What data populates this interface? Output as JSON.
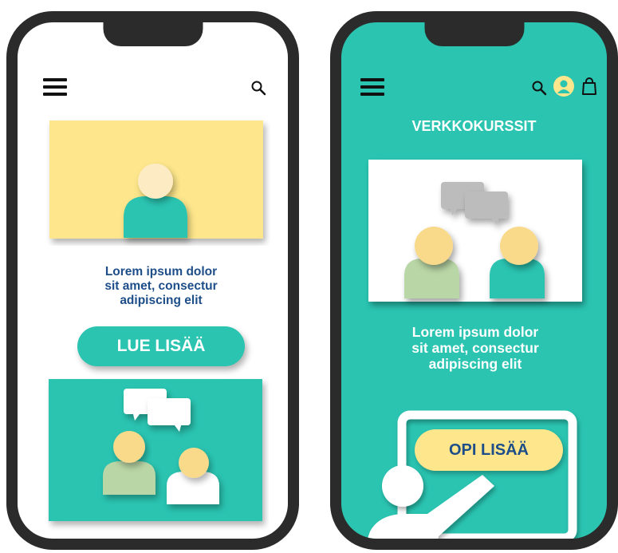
{
  "left_screen": {
    "menu_icon": "hamburger-menu-icon",
    "search_icon": "search-icon",
    "body_text": {
      "line1": "Lorem ipsum dolor",
      "line2": "sit amet, consectur",
      "line3": "adipiscing elit"
    },
    "cta_label": "LUE LISÄÄ"
  },
  "right_screen": {
    "menu_icon": "hamburger-menu-icon",
    "search_icon": "search-icon",
    "account_icon": "user-avatar-icon",
    "cart_icon": "shopping-bag-icon",
    "heading": "VERKKOKURSSIT",
    "body_text": {
      "line1": "Lorem ipsum dolor",
      "line2": "sit amet, consectur",
      "line3": "adipiscing elit"
    },
    "cta_label": "OPI LISÄÄ"
  },
  "colors": {
    "teal": "#2ac4b1",
    "yellow": "#fde68b",
    "navy_text": "#1d4e89",
    "face": "#f9d98a",
    "sage": "#b9d6a6",
    "frame": "#2b2b2b"
  }
}
